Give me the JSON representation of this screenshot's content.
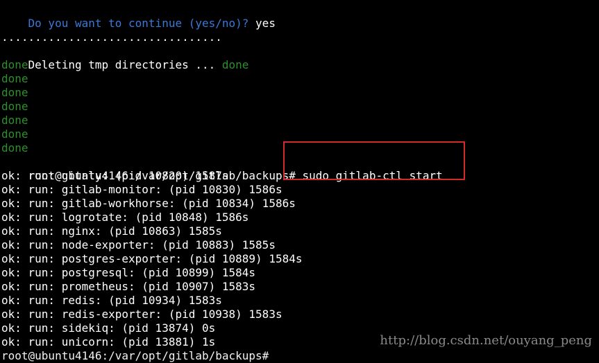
{
  "colors": {
    "background": "#000000",
    "text": "#ffffff",
    "question": "#3b78d8",
    "done": "#2f8f2f",
    "highlight": "#d32a2a",
    "watermark": "#9a9a9a"
  },
  "terminal": {
    "question": {
      "text": "Do you want to continue (yes/no)? ",
      "answer": "yes"
    },
    "dots": ".................................",
    "deleting": {
      "text": "Deleting tmp directories ... ",
      "status": "done"
    },
    "done_lines": [
      "done",
      "done",
      "done",
      "done",
      "done",
      "done",
      "done"
    ],
    "prompt": {
      "prefix": "root@ubuntu4146:/var/opt/gitlab/backups# ",
      "command": "sudo gitlab-ctl start"
    },
    "services": [
      "ok: run: gitaly: (pid 10820) 1587s",
      "ok: run: gitlab-monitor: (pid 10830) 1586s",
      "ok: run: gitlab-workhorse: (pid 10834) 1586s",
      "ok: run: logrotate: (pid 10848) 1586s",
      "ok: run: nginx: (pid 10863) 1585s",
      "ok: run: node-exporter: (pid 10883) 1585s",
      "ok: run: postgres-exporter: (pid 10889) 1584s",
      "ok: run: postgresql: (pid 10899) 1584s",
      "ok: run: prometheus: (pid 10907) 1583s",
      "ok: run: redis: (pid 10934) 1583s",
      "ok: run: redis-exporter: (pid 10938) 1583s",
      "ok: run: sidekiq: (pid 13874) 0s",
      "ok: run: unicorn: (pid 13881) 1s"
    ],
    "next_prompt": "root@ubuntu4146:/var/opt/gitlab/backups# "
  },
  "watermark": "http://blog.csdn.net/ouyang_peng"
}
